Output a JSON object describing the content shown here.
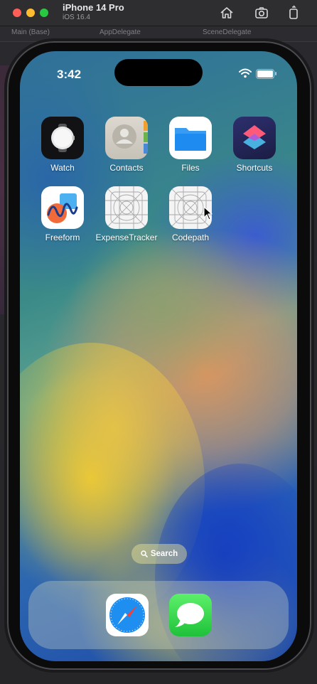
{
  "simulator": {
    "device_name": "iPhone 14 Pro",
    "os_version": "iOS 16.4",
    "toolbar_icons": [
      "home-icon",
      "screenshot-icon",
      "rotate-icon"
    ]
  },
  "background_window": {
    "tabs": [
      "Main (Base)",
      "AppDelegate",
      "SceneDelegate"
    ]
  },
  "status_bar": {
    "time": "3:42",
    "icons": [
      "wifi-icon",
      "battery-icon"
    ]
  },
  "home_screen": {
    "apps": [
      {
        "name": "Watch",
        "icon": "watch-app-icon"
      },
      {
        "name": "Contacts",
        "icon": "contacts-app-icon"
      },
      {
        "name": "Files",
        "icon": "files-app-icon"
      },
      {
        "name": "Shortcuts",
        "icon": "shortcuts-app-icon"
      },
      {
        "name": "Freeform",
        "icon": "freeform-app-icon"
      },
      {
        "name": "ExpenseTracker",
        "icon": "placeholder-app-icon"
      },
      {
        "name": "Codepath",
        "icon": "placeholder-app-icon"
      }
    ],
    "search_label": "Search",
    "dock": [
      {
        "name": "Safari",
        "icon": "safari-app-icon"
      },
      {
        "name": "Messages",
        "icon": "messages-app-icon"
      }
    ]
  }
}
